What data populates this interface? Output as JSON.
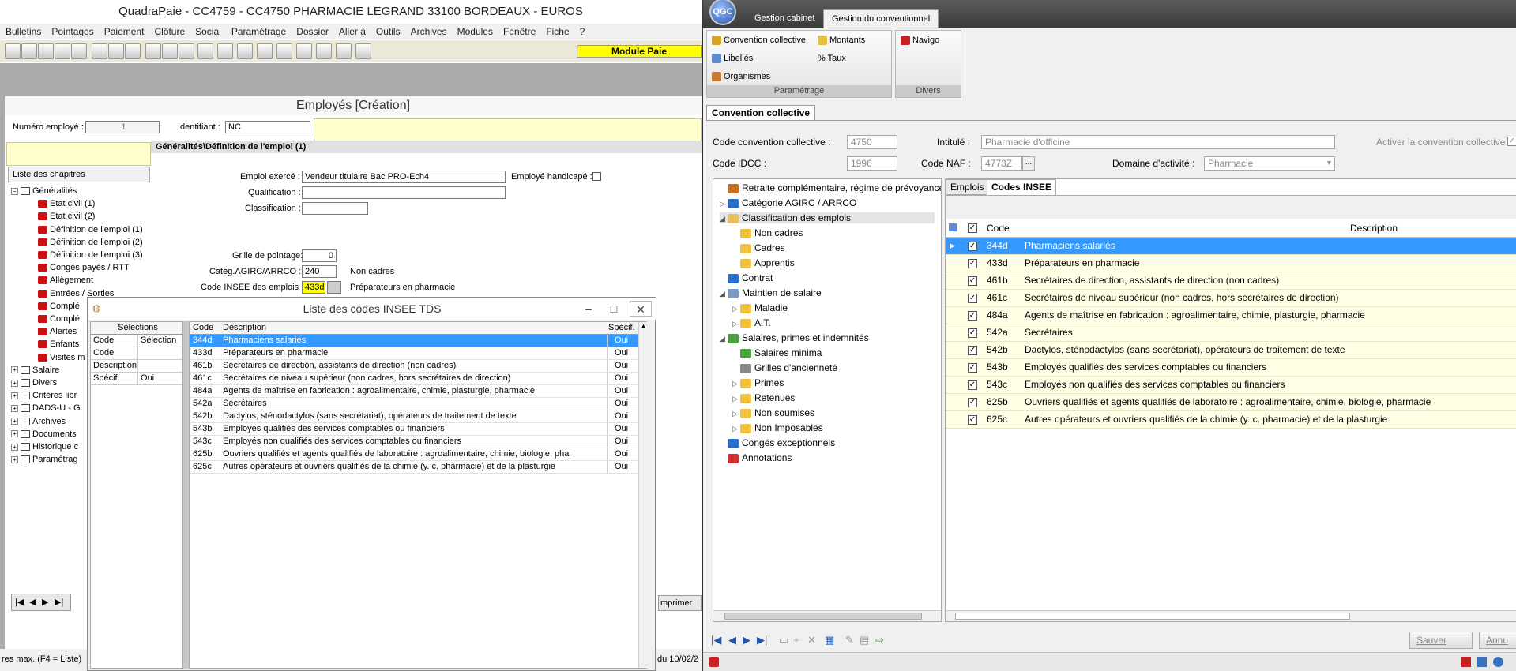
{
  "left_window": {
    "title": "QuadraPaie - CC4759 - CC4750 PHARMACIE LEGRAND 33100 BORDEAUX - EUROS",
    "menu": [
      "Bulletins",
      "Pointages",
      "Paiement",
      "Clôture",
      "Social",
      "Paramétrage",
      "Dossier",
      "Aller à",
      "Outils",
      "Archives",
      "Modules",
      "Fenêtre",
      "Fiche",
      "?"
    ],
    "module_badge": "Module Paie",
    "employes": {
      "title": "Employés   [Création]",
      "numero_label": "Numéro employé :",
      "numero_value": "1",
      "identifiant_label": "Identifiant :",
      "identifiant_value": "NC",
      "section_header": "Généralités\\Définition de l'emploi (1)",
      "chapters_header": "Liste des chapitres",
      "chapters": [
        {
          "label": "Généralités",
          "type": "folder",
          "expanded": true
        },
        {
          "label": "Etat civil (1)",
          "type": "red"
        },
        {
          "label": "Etat civil (2)",
          "type": "red"
        },
        {
          "label": "Définition de l'emploi (1)",
          "type": "red"
        },
        {
          "label": "Définition de l'emploi (2)",
          "type": "red"
        },
        {
          "label": "Définition de l'emploi (3)",
          "type": "red"
        },
        {
          "label": "Congés payés / RTT",
          "type": "red"
        },
        {
          "label": "Allègement",
          "type": "red"
        },
        {
          "label": "Entrées / Sorties",
          "type": "red"
        },
        {
          "label": "Complé",
          "type": "red"
        },
        {
          "label": "Complé",
          "type": "red"
        },
        {
          "label": "Alertes",
          "type": "red"
        },
        {
          "label": "Enfants",
          "type": "red"
        },
        {
          "label": "Visites m",
          "type": "red"
        },
        {
          "label": "Salaire",
          "type": "folder"
        },
        {
          "label": "Divers",
          "type": "folder"
        },
        {
          "label": "Critères libr",
          "type": "folder"
        },
        {
          "label": "DADS-U - G",
          "type": "folder"
        },
        {
          "label": "Archives",
          "type": "folder"
        },
        {
          "label": "Documents",
          "type": "folder"
        },
        {
          "label": "Historique c",
          "type": "folder"
        },
        {
          "label": "Paramétrag",
          "type": "folder"
        }
      ],
      "fields": {
        "emploi_label": "Emploi exercé :",
        "emploi_value": "Vendeur titulaire Bac PRO-Ech4",
        "handicape_label": "Employé handicapé :",
        "qualification_label": "Qualification :",
        "classification_label": "Classification :",
        "grille_label": "Grille de pointage:",
        "grille_value": "0",
        "categ_label": "Catég.AGIRC/ARRCO :",
        "categ_value": "240",
        "categ_text": "Non cadres",
        "insee_label": "Code INSEE des emplois :",
        "insee_value": "433d",
        "insee_text": "Préparateurs en pharmacie"
      },
      "status_left": "res max. (F4 = Liste)",
      "status_right": "du 10/02/2",
      "imprimer": "mprimer"
    },
    "dialog": {
      "title": "Liste des codes INSEE TDS",
      "selections_header": "Sélections",
      "sel_cols": [
        "Code",
        "Sélection"
      ],
      "sel_rows": [
        [
          "Code",
          ""
        ],
        [
          "Description",
          ""
        ],
        [
          "Spécif.",
          "Oui"
        ]
      ],
      "cols": [
        "Code",
        "Description",
        "Spécif."
      ],
      "rows": [
        [
          "344d",
          "Pharmaciens salariés",
          "Oui"
        ],
        [
          "433d",
          "Préparateurs en pharmacie",
          "Oui"
        ],
        [
          "461b",
          "Secrétaires de direction, assistants de direction (non cadres)",
          "Oui"
        ],
        [
          "461c",
          "Secrétaires de niveau supérieur (non cadres, hors secrétaires de direction)",
          "Oui"
        ],
        [
          "484a",
          "Agents de maîtrise en fabrication : agroalimentaire, chimie, plasturgie, pharmacie",
          "Oui"
        ],
        [
          "542a",
          "Secrétaires",
          "Oui"
        ],
        [
          "542b",
          "Dactylos, sténodactylos (sans secrétariat), opérateurs de traitement de texte",
          "Oui"
        ],
        [
          "543b",
          "Employés qualifiés des services comptables ou financiers",
          "Oui"
        ],
        [
          "543c",
          "Employés non qualifiés des services comptables ou financiers",
          "Oui"
        ],
        [
          "625b",
          "Ouvriers qualifiés et agents qualifiés de laboratoire : agroalimentaire, chimie, biologie, pharmacie",
          "Oui"
        ],
        [
          "625c",
          "Autres opérateurs et ouvriers qualifiés de la chimie (y. c. pharmacie) et de la plasturgie",
          "Oui"
        ]
      ]
    }
  },
  "right_window": {
    "logo": "QGC",
    "tabs": [
      "Gestion cabinet",
      "Gestion du conventionnel"
    ],
    "ribbon": {
      "group1_label": "Paramétrage",
      "group1_items": [
        "Convention collective",
        "Montants",
        "Libellés",
        "% Taux",
        "Organismes"
      ],
      "group2_label": "Divers",
      "group2_items": [
        "Navigo"
      ]
    },
    "panel_title": "Convention collective",
    "form": {
      "code_cc_label": "Code convention collective :",
      "code_cc_value": "4750",
      "intitule_label": "Intitulé :",
      "intitule_value": "Pharmacie d'officine",
      "activer_label": "Activer la convention collective",
      "idcc_label": "Code IDCC :",
      "idcc_value": "1996",
      "naf_label": "Code NAF :",
      "naf_value": "4773Z",
      "domaine_label": "Domaine d'activité :",
      "domaine_value": "Pharmacie"
    },
    "tree": [
      {
        "label": "Retraite complémentaire, régime de prévoyance",
        "level": 0,
        "arrow": "",
        "icon": "#c87020"
      },
      {
        "label": "Catégorie AGIRC / ARRCO",
        "level": 0,
        "arrow": "▷",
        "icon": "#2a6fc9"
      },
      {
        "label": "Classification des emplois",
        "level": 0,
        "arrow": "◢",
        "icon": "#e8c060",
        "selected": true
      },
      {
        "label": "Non cadres",
        "level": 1,
        "arrow": "",
        "icon": "#f0c040"
      },
      {
        "label": "Cadres",
        "level": 1,
        "arrow": "",
        "icon": "#f0c040"
      },
      {
        "label": "Apprentis",
        "level": 1,
        "arrow": "",
        "icon": "#f0c040"
      },
      {
        "label": "Contrat",
        "level": 0,
        "arrow": "",
        "icon": "#2a6fc9"
      },
      {
        "label": "Maintien de salaire",
        "level": 0,
        "arrow": "◢",
        "icon": "#7a9ac0"
      },
      {
        "label": "Maladie",
        "level": 1,
        "arrow": "▷",
        "icon": "#f0c040"
      },
      {
        "label": "A.T.",
        "level": 1,
        "arrow": "▷",
        "icon": "#f0c040"
      },
      {
        "label": "Salaires, primes et indemnités",
        "level": 0,
        "arrow": "◢",
        "icon": "#4aa040"
      },
      {
        "label": "Salaires minima",
        "level": 1,
        "arrow": "",
        "icon": "#4aa040"
      },
      {
        "label": "Grilles d'ancienneté",
        "level": 1,
        "arrow": "",
        "icon": "#888888"
      },
      {
        "label": "Primes",
        "level": 1,
        "arrow": "▷",
        "icon": "#f0c040"
      },
      {
        "label": "Retenues",
        "level": 1,
        "arrow": "▷",
        "icon": "#f0c040"
      },
      {
        "label": "Non soumises",
        "level": 1,
        "arrow": "▷",
        "icon": "#f0c040"
      },
      {
        "label": "Non Imposables",
        "level": 1,
        "arrow": "▷",
        "icon": "#f0c040"
      },
      {
        "label": "Congés exceptionnels",
        "level": 0,
        "arrow": "",
        "icon": "#2a6fc9"
      },
      {
        "label": "Annotations",
        "level": 0,
        "arrow": "",
        "icon": "#d03030"
      }
    ],
    "grid": {
      "tabs": [
        "Emplois",
        "Codes INSEE"
      ],
      "cols": [
        "Code",
        "Description"
      ],
      "rows": [
        [
          "344d",
          "Pharmaciens salariés"
        ],
        [
          "433d",
          "Préparateurs en pharmacie"
        ],
        [
          "461b",
          "Secrétaires de direction, assistants de direction (non cadres)"
        ],
        [
          "461c",
          "Secrétaires de niveau supérieur (non cadres, hors secrétaires de direction)"
        ],
        [
          "484a",
          "Agents de maîtrise en fabrication : agroalimentaire, chimie, plasturgie, pharmacie"
        ],
        [
          "542a",
          "Secrétaires"
        ],
        [
          "542b",
          "Dactylos, sténodactylos (sans secrétariat), opérateurs de traitement de texte"
        ],
        [
          "543b",
          "Employés qualifiés des services comptables ou financiers"
        ],
        [
          "543c",
          "Employés non qualifiés des services comptables ou financiers"
        ],
        [
          "625b",
          "Ouvriers qualifiés et agents qualifiés de laboratoire : agroalimentaire, chimie, biologie, pharmacie"
        ],
        [
          "625c",
          "Autres opérateurs et ouvriers qualifiés de la chimie (y. c. pharmacie) et de la plasturgie"
        ]
      ]
    },
    "buttons": {
      "save": "Sauver",
      "cancel": "Annu"
    }
  },
  "colors": {
    "selection": "#3399ff",
    "yellow_row": "#ffffe6",
    "module_badge": "#ffff00"
  }
}
